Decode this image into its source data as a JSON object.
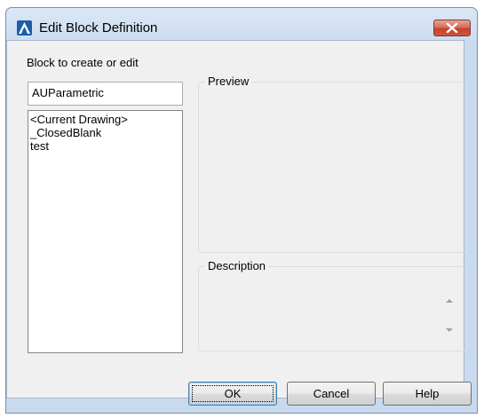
{
  "window": {
    "title": "Edit Block Definition",
    "app_icon": "autocad-icon",
    "close_icon": "close-icon"
  },
  "block_section": {
    "label": "Block to create or edit",
    "input_value": "AUParametric",
    "list_items": [
      "<Current Drawing>",
      "_ClosedBlank",
      "test"
    ]
  },
  "preview": {
    "label": "Preview"
  },
  "description": {
    "label": "Description",
    "value": ""
  },
  "buttons": {
    "ok": "OK",
    "cancel": "Cancel",
    "help": "Help"
  },
  "colors": {
    "titlebar": "#c9daef",
    "client_bg": "#f0f0f0",
    "close_button": "#c2432b",
    "ok_border": "#3c7fb1"
  }
}
